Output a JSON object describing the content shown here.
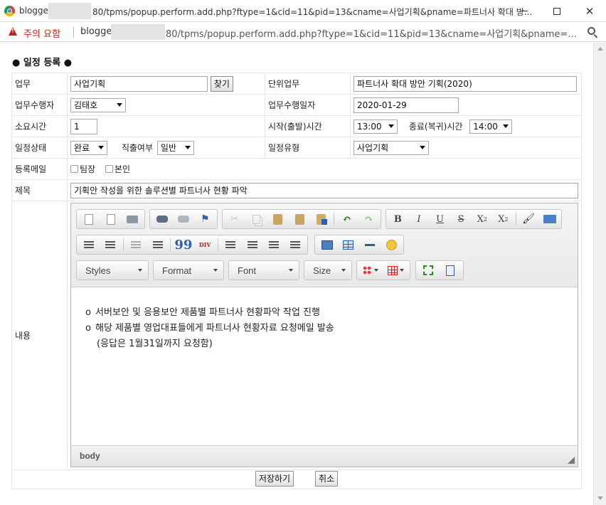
{
  "window": {
    "title_host": "blogger",
    "title_path": "80/tpms/popup.perform.add.php?ftype=1&cid=11&pid=13&cname=사업기획&pname=파트너사 확대 방...",
    "controls": {
      "minimize": "minimize",
      "maximize": "maximize",
      "close": "✕"
    }
  },
  "addressbar": {
    "security_warning": "주의 요함",
    "host": "blogge",
    "path": "80/tpms/popup.perform.add.php?ftype=1&cid=11&pid=13&cname=사업기획&pname=..."
  },
  "page": {
    "heading": "● 일정 등록 ●"
  },
  "form": {
    "task": {
      "label": "업무",
      "value": "사업기획",
      "find_button": "찾기"
    },
    "unit_task": {
      "label": "단위업무",
      "value": "파트너사 확대 방안 기획(2020)"
    },
    "assignee": {
      "label": "업무수행자",
      "value": "김태호"
    },
    "work_date": {
      "label": "업무수행일자",
      "value": "2020-01-29"
    },
    "duration": {
      "label": "소요시간",
      "value": "1"
    },
    "start_time": {
      "label": "시작(출발)시간",
      "value": "13:00"
    },
    "end_time": {
      "label": "종료(복귀)시간",
      "value": "14:00"
    },
    "status": {
      "label": "일정상태",
      "value": "완료"
    },
    "direct_return": {
      "label": "직출여부",
      "value": "일반"
    },
    "schedule_type": {
      "label": "일정유형",
      "value": "사업기획"
    },
    "notify_mail": {
      "label": "등록메일",
      "options": [
        "팀장",
        "본인"
      ]
    },
    "subject": {
      "label": "제목",
      "value": "기획안 작성을 위한 솔루션별 파트너사 현황 파악"
    },
    "content_label": "내용"
  },
  "editor": {
    "combos": {
      "styles": "Styles",
      "format": "Format",
      "font": "Font",
      "size": "Size"
    },
    "toolbar_text": {
      "bold": "B",
      "italic": "I",
      "underline": "U",
      "strike": "S",
      "subscript": "X",
      "sub_mark": "2",
      "superscript": "X",
      "super_mark": "2",
      "blockquote": "99",
      "div": "DIV"
    },
    "lines": [
      {
        "bullet": "o",
        "text": "서버보안 및 응용보안 제품별 파트너사 현황파악 작업 진행"
      },
      {
        "bullet": "o",
        "text": "해당 제품별 영업대표들에게 파트너사 현황자료 요청메일 발송"
      },
      {
        "bullet": "",
        "text": "(응답은 1월31일까지 요청함)"
      }
    ],
    "status_path": "body"
  },
  "buttons": {
    "save": "저장하기",
    "cancel": "취소"
  }
}
